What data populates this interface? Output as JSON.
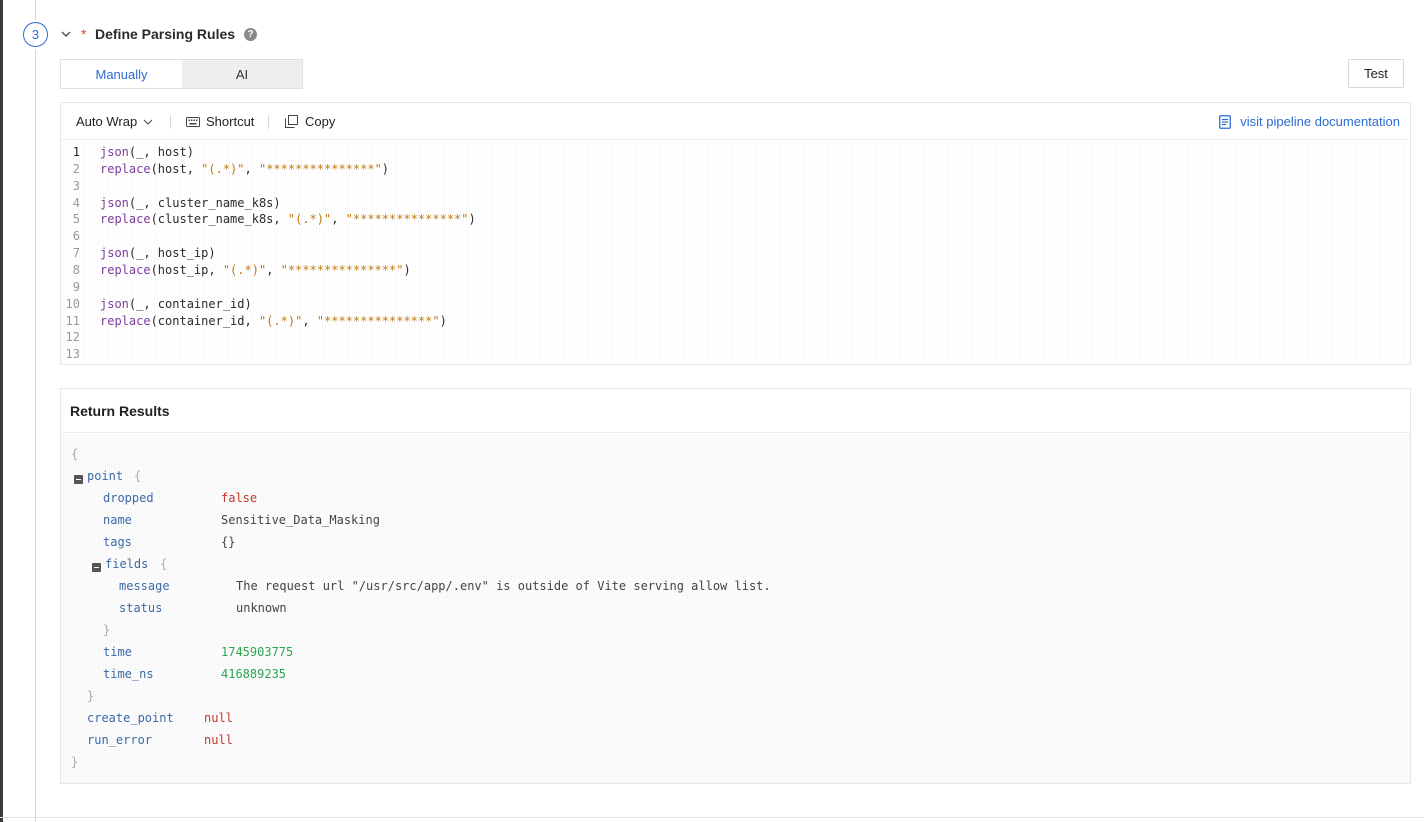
{
  "step": {
    "number": "3",
    "required_mark": "*",
    "title": "Define Parsing Rules",
    "help_icon": "question-circle-icon"
  },
  "mode_tabs": [
    {
      "label": "Manually",
      "active": true
    },
    {
      "label": "AI",
      "active": false
    }
  ],
  "test_button": "Test",
  "editor": {
    "toolbar": {
      "wrap_label": "Auto Wrap",
      "shortcut_label": "Shortcut",
      "copy_label": "Copy",
      "doc_link": "visit pipeline documentation"
    },
    "lines": [
      {
        "n": "1",
        "tokens": [
          {
            "t": "kw",
            "v": "json"
          },
          {
            "t": "plain",
            "v": "(_, host)"
          }
        ]
      },
      {
        "n": "2",
        "tokens": [
          {
            "t": "kw",
            "v": "replace"
          },
          {
            "t": "plain",
            "v": "(host, "
          },
          {
            "t": "str",
            "v": "\"(.*)\""
          },
          {
            "t": "plain",
            "v": ", "
          },
          {
            "t": "str",
            "v": "\"***************\""
          },
          {
            "t": "plain",
            "v": ")"
          }
        ]
      },
      {
        "n": "3",
        "tokens": []
      },
      {
        "n": "4",
        "tokens": [
          {
            "t": "kw",
            "v": "json"
          },
          {
            "t": "plain",
            "v": "(_, cluster_name_k8s)"
          }
        ]
      },
      {
        "n": "5",
        "tokens": [
          {
            "t": "kw",
            "v": "replace"
          },
          {
            "t": "plain",
            "v": "(cluster_name_k8s, "
          },
          {
            "t": "str",
            "v": "\"(.*)\""
          },
          {
            "t": "plain",
            "v": ", "
          },
          {
            "t": "str",
            "v": "\"***************\""
          },
          {
            "t": "plain",
            "v": ")"
          }
        ]
      },
      {
        "n": "6",
        "tokens": []
      },
      {
        "n": "7",
        "tokens": [
          {
            "t": "kw",
            "v": "json"
          },
          {
            "t": "plain",
            "v": "(_, host_ip)"
          }
        ]
      },
      {
        "n": "8",
        "tokens": [
          {
            "t": "kw",
            "v": "replace"
          },
          {
            "t": "plain",
            "v": "(host_ip, "
          },
          {
            "t": "str",
            "v": "\"(.*)\""
          },
          {
            "t": "plain",
            "v": ", "
          },
          {
            "t": "str",
            "v": "\"***************\""
          },
          {
            "t": "plain",
            "v": ")"
          }
        ]
      },
      {
        "n": "9",
        "tokens": []
      },
      {
        "n": "10",
        "tokens": [
          {
            "t": "kw",
            "v": "json"
          },
          {
            "t": "plain",
            "v": "(_, container_id)"
          }
        ]
      },
      {
        "n": "11",
        "tokens": [
          {
            "t": "kw",
            "v": "replace"
          },
          {
            "t": "plain",
            "v": "(container_id, "
          },
          {
            "t": "str",
            "v": "\"(.*)\""
          },
          {
            "t": "plain",
            "v": ", "
          },
          {
            "t": "str",
            "v": "\"***************\""
          },
          {
            "t": "plain",
            "v": ")"
          }
        ]
      },
      {
        "n": "12",
        "tokens": []
      },
      {
        "n": "13",
        "tokens": []
      }
    ]
  },
  "results": {
    "title": "Return Results",
    "open_brace": "{",
    "close_brace": "}",
    "point_key": "point",
    "point_fields": {
      "dropped": {
        "key": "dropped",
        "value": "false"
      },
      "name": {
        "key": "name",
        "value": "Sensitive_Data_Masking"
      },
      "tags": {
        "key": "tags",
        "value": "{}"
      },
      "fields_key": "fields",
      "message": {
        "key": "message",
        "value": "The request url \"/usr/src/app/.env\" is outside of Vite serving allow list."
      },
      "status": {
        "key": "status",
        "value": "unknown"
      },
      "time": {
        "key": "time",
        "value": "1745903775"
      },
      "time_ns": {
        "key": "time_ns",
        "value": "416889235"
      }
    },
    "create_point": {
      "key": "create_point",
      "value": "null"
    },
    "run_error": {
      "key": "run_error",
      "value": "null"
    }
  }
}
